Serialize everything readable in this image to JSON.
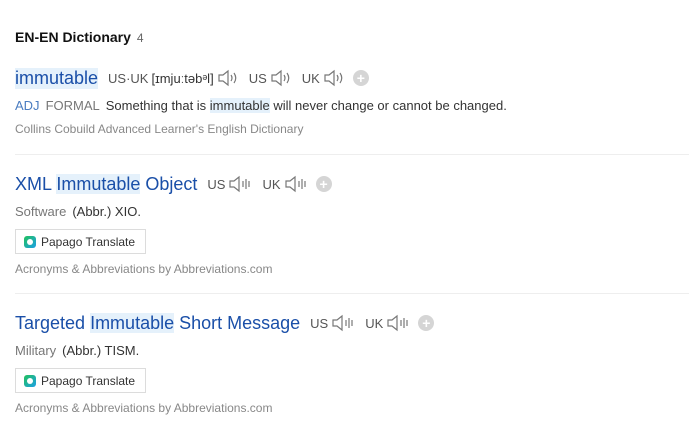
{
  "section": {
    "title": "EN-EN Dictionary",
    "count": "4"
  },
  "entries": [
    {
      "headword": "immutable",
      "pron_us_uk_label": "US·UK",
      "phonetic": "[ɪmjuːtəbᵊl]",
      "us_label": "US",
      "uk_label": "UK",
      "pos": "ADJ",
      "register": "FORMAL",
      "meaning_pre": "Something that is ",
      "meaning_hl": "immutable",
      "meaning_post": " will never change or cannot be changed.",
      "source": "Collins Cobuild Advanced Learner's English Dictionary"
    },
    {
      "headword_pre": "XML ",
      "headword_hl": "Immutable",
      "headword_post": " Object",
      "us_label": "US",
      "uk_label": "UK",
      "domain": "Software",
      "abbr": "(Abbr.) XIO.",
      "translate_label": "Papago Translate",
      "source": "Acronyms & Abbreviations by Abbreviations.com"
    },
    {
      "headword_pre": "Targeted ",
      "headword_hl": "Immutable",
      "headword_post": " Short Message",
      "us_label": "US",
      "uk_label": "UK",
      "domain": "Military",
      "abbr": "(Abbr.) TISM.",
      "translate_label": "Papago Translate",
      "source": "Acronyms & Abbreviations by Abbreviations.com"
    }
  ],
  "icons": {
    "speaker": "speaker-icon",
    "add": "plus-icon",
    "papago": "papago-icon"
  },
  "colors": {
    "headword": "#1a4fa8",
    "highlight": "#e5f1fb",
    "pos": "#4a7cc0"
  },
  "add_symbol": "+"
}
